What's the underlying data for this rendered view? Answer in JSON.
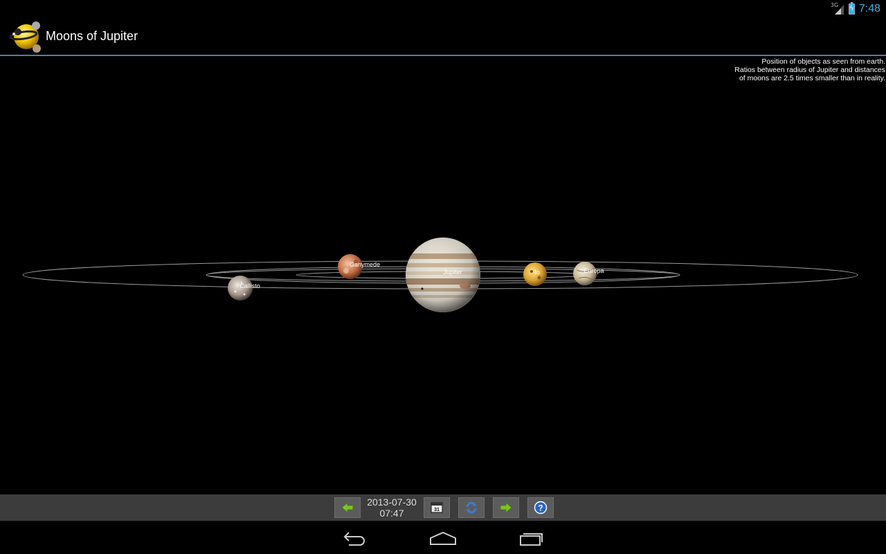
{
  "status": {
    "network": "3G",
    "time": "7:48"
  },
  "app": {
    "title": "Moons of Jupiter"
  },
  "note": {
    "line1": "Position of objects as seen from earth.",
    "line2": "Ratios between radius of Jupiter and distances",
    "line3": "of moons are 2.5 times smaller than in reality."
  },
  "bodies": {
    "jupiter": "Jupiter",
    "io": "Io",
    "europa": "Europa",
    "ganymede": "Ganymede",
    "callisto": "Callisto"
  },
  "toolbar": {
    "date": "2013-07-30",
    "time": "07:47",
    "calendar_day": "31",
    "icons": [
      "arrow-left-icon",
      "calendar-icon",
      "refresh-icon",
      "arrow-right-icon",
      "help-icon"
    ]
  },
  "nav": {
    "icons": [
      "back-icon",
      "home-icon",
      "recent-apps-icon"
    ]
  },
  "colors": {
    "accent": "#33b5e5",
    "divider": "#4f7fa8",
    "toolbar": "#3c3c3c"
  }
}
